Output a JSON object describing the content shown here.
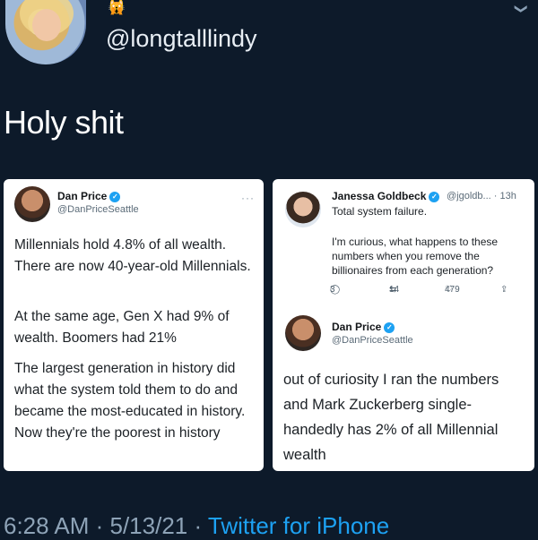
{
  "header": {
    "handle": "@longtalllindy",
    "emoji": "🙀"
  },
  "tweet": {
    "text": "Holy shit",
    "footer_time": "6:28 AM · 5/13/21 · ",
    "footer_source": "Twitter for iPhone"
  },
  "left_card": {
    "name": "Dan Price",
    "handle": "@DanPriceSeattle",
    "p1": "Millennials hold 4.8% of all wealth. There are now 40-year-old Millennials.",
    "p2": "At the same age, Gen X had 9% of wealth. Boomers had 21%",
    "p3": "The largest generation in history did what the system told them to do and became the most-educated in history. Now they're the poorest in history",
    "more": "···"
  },
  "right_card": {
    "quote": {
      "name": "Janessa Goldbeck",
      "handle_time": "@jgoldb... · 13h",
      "line1": "Total system failure.",
      "body": "I'm curious, what happens to these numbers when you remove the billionaires from each generation?",
      "replies": "3",
      "retweets": "14",
      "likes": "479"
    },
    "reply": {
      "name": "Dan Price",
      "handle": "@DanPriceSeattle",
      "body": "out of curiosity I ran the numbers and Mark Zuckerberg single-handedly has 2% of all Millennial wealth"
    }
  }
}
